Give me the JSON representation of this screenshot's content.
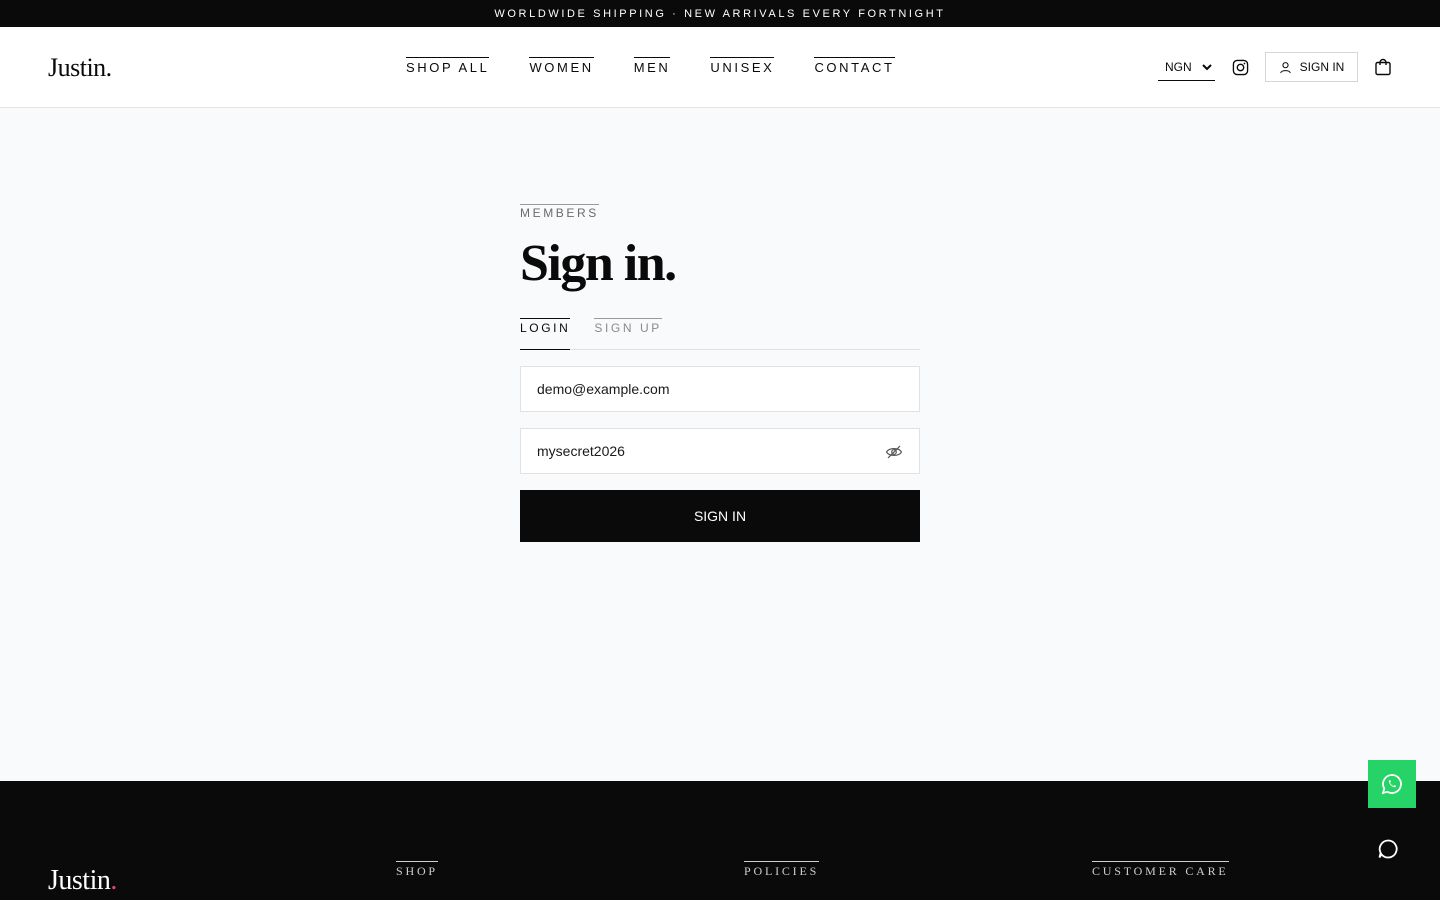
{
  "announcement": "WORLDWIDE SHIPPING · NEW ARRIVALS EVERY FORTNIGHT",
  "header": {
    "logo": "Justin.",
    "nav": [
      "SHOP ALL",
      "WOMEN",
      "MEN",
      "UNISEX",
      "CONTACT"
    ],
    "currency": "NGN",
    "signin_label": "SIGN IN"
  },
  "form": {
    "eyebrow": "MEMBERS",
    "title": "Sign in.",
    "tabs": [
      "LOGIN",
      "SIGN UP"
    ],
    "active_tab": "LOGIN",
    "email_value": "demo@example.com",
    "password_value": "mysecret2026",
    "submit_label": "SIGN IN"
  },
  "footer": {
    "logo_text": "Justin",
    "logo_dot": ".",
    "columns": [
      "SHOP",
      "POLICIES",
      "CUSTOMER CARE"
    ]
  },
  "colors": {
    "whatsapp": "#25d366",
    "logo_dot": "#e0456b",
    "primary": "#0a0a0a"
  }
}
